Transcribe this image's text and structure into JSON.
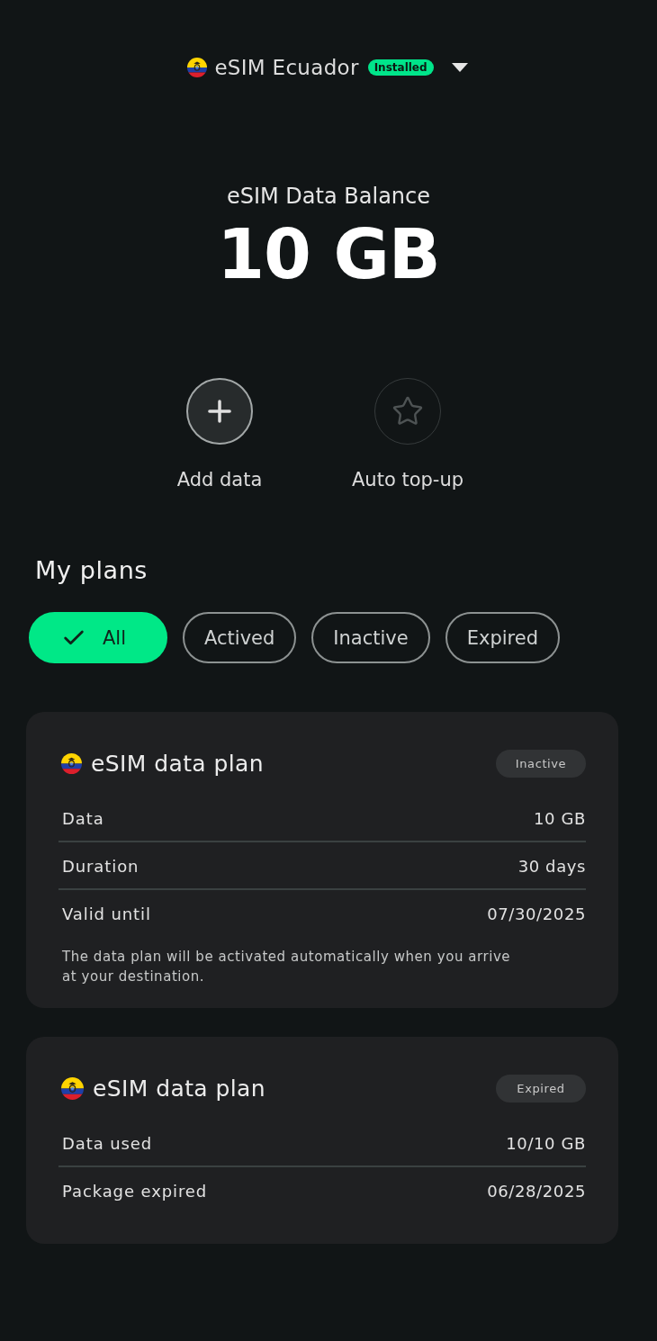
{
  "header": {
    "title": "eSIM Ecuador",
    "badge": "Installed"
  },
  "balance": {
    "label": "eSIM Data Balance",
    "value": "10 GB"
  },
  "actions": [
    {
      "kind": "add",
      "label": "Add data",
      "disabled": false
    },
    {
      "kind": "auto",
      "label": "Auto top-up",
      "disabled": true
    }
  ],
  "plans_section": {
    "title": "My plans",
    "filters": [
      {
        "label": "All",
        "selected": true
      },
      {
        "label": "Actived",
        "selected": false
      },
      {
        "label": "Inactive",
        "selected": false
      },
      {
        "label": "Expired",
        "selected": false
      }
    ]
  },
  "plans": [
    {
      "title": "eSIM data plan",
      "status": "Inactive",
      "rows": [
        {
          "label": "Data",
          "value": "10 GB"
        },
        {
          "label": "Duration",
          "value": "30 days"
        },
        {
          "label": "Valid until",
          "value": "07/30/2025"
        }
      ],
      "note": "The data plan will be activated automatically when you arrive at your destination."
    },
    {
      "title": "eSIM data plan",
      "status": "Expired",
      "rows": [
        {
          "label": "Data used",
          "value": "10/10 GB"
        },
        {
          "label": "Package expired",
          "value": "06/28/2025"
        }
      ]
    }
  ]
}
